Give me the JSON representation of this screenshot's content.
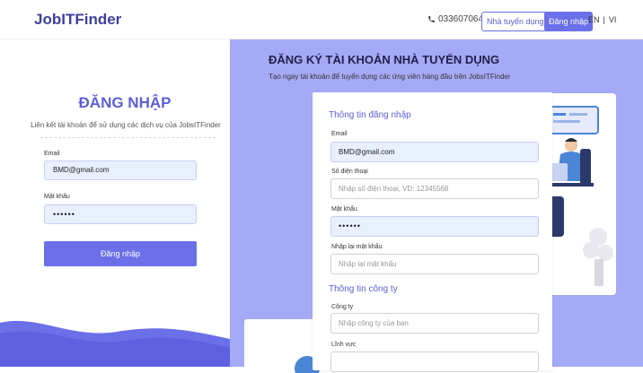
{
  "header": {
    "logo": "JobITFinder",
    "phone_icon": "phone-icon",
    "phone": "0336070648",
    "recruiter_label": "Nhà tuyển dụng",
    "login_label": "Đăng nhập",
    "lang_en": "EN",
    "lang_sep": "|",
    "lang_vi": "VI"
  },
  "login": {
    "title": "ĐĂNG NHẬP",
    "subtitle": "Liên kết tài khoản để sử dụng các dịch vụ của JobsITFinder",
    "email_label": "Email",
    "email_value": "BMD@gmail.com",
    "password_label": "Mật khẩu",
    "password_value": "••••••",
    "submit_label": "Đăng nhập"
  },
  "register": {
    "title": "ĐĂNG KÝ TÀI KHOẢN NHÀ TUYỂN DỤNG",
    "subtitle": "Tạo ngay tài khoản để tuyển dụng các ứng viên hàng đầu trên JobsITFinder",
    "section_login": "Thông tin đăng nhập",
    "email_label": "Email",
    "email_value": "BMD@gmail.com",
    "phone_label": "Số điện thoại",
    "phone_placeholder": "Nhập số điện thoại, VD: 12345568",
    "password_label": "Mật khẩu",
    "password_value": "••••••",
    "confirm_label": "Nhập lại mật khẩu",
    "confirm_placeholder": "Nhập lại mật khẩu",
    "section_company": "Thông tin công ty",
    "company_label": "Công ty",
    "company_placeholder": "Nhập công ty của bạn",
    "field_label": "Lĩnh vực"
  },
  "colors": {
    "accent": "#6b6fe8",
    "panel": "#a5aaf6",
    "logo": "#3f3f9e"
  }
}
